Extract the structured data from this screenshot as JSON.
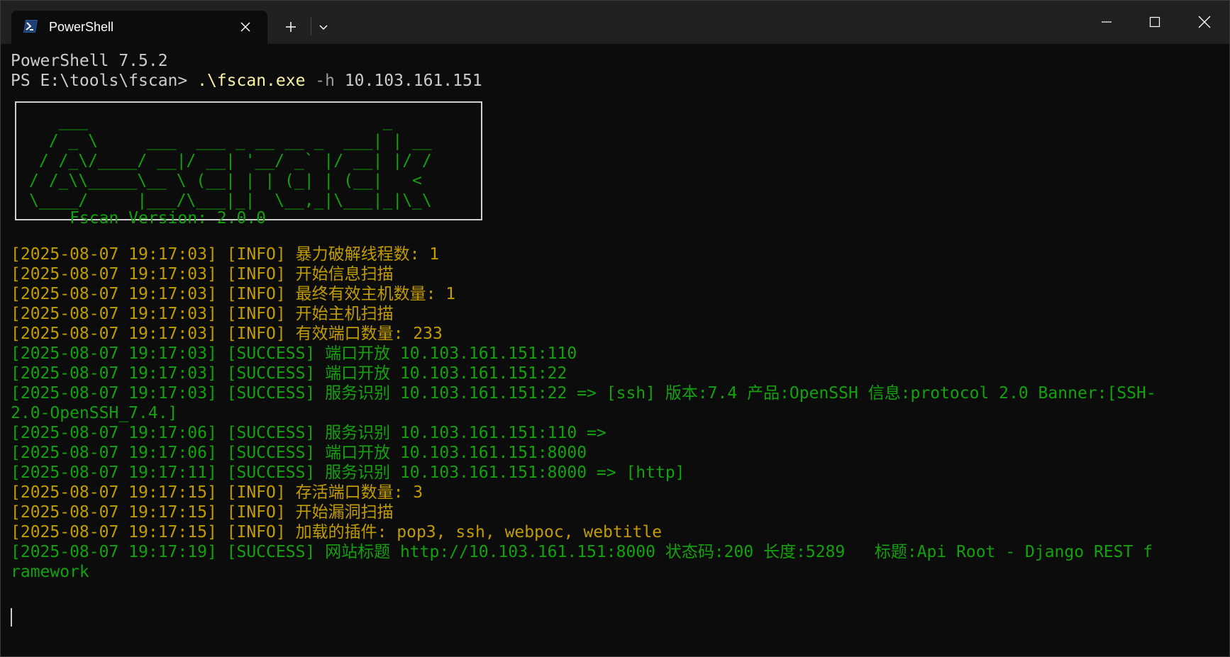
{
  "window": {
    "tab_title": "PowerShell",
    "icons": {
      "tab": "powershell-icon",
      "tab_close": "close-icon",
      "new_tab": "plus-icon",
      "dropdown": "chevron-down-icon",
      "minimize": "minimize-icon",
      "maximize": "maximize-icon",
      "close": "close-icon"
    }
  },
  "colors": {
    "background": "#0c0c0c",
    "titlebar": "#202020",
    "info": "#c19c00",
    "success": "#13a10e",
    "command": "#f9f1a5"
  },
  "terminal": {
    "version_line": "PowerShell 7.5.2",
    "prompt": "PS E:\\tools\\fscan> ",
    "command": ".\\fscan.exe",
    "flag": " -h",
    "argument": " 10.103.161.151",
    "banner": "   ___                              _    \n  / _ \\     ___  ___ _ __ __ _  ___| | __\n / /_\\/____/ __|/ __| '__/ _` |/ __| |/ /\n/ /_\\\\_____\\__ \\ (__| | | (_| | (__|   < \n\\____/     |___/\\___|_|  \\__,_|\\___|_|\\_\\",
    "fscan_version": "      Fscan Version: 2.0.0",
    "log": [
      {
        "type": "info",
        "text": "[2025-08-07 19:17:03] [INFO] 暴力破解线程数: 1"
      },
      {
        "type": "info",
        "text": "[2025-08-07 19:17:03] [INFO] 开始信息扫描"
      },
      {
        "type": "info",
        "text": "[2025-08-07 19:17:03] [INFO] 最终有效主机数量: 1"
      },
      {
        "type": "info",
        "text": "[2025-08-07 19:17:03] [INFO] 开始主机扫描"
      },
      {
        "type": "info",
        "text": "[2025-08-07 19:17:03] [INFO] 有效端口数量: 233"
      },
      {
        "type": "success",
        "text": "[2025-08-07 19:17:03] [SUCCESS] 端口开放 10.103.161.151:110"
      },
      {
        "type": "success",
        "text": "[2025-08-07 19:17:03] [SUCCESS] 端口开放 10.103.161.151:22"
      },
      {
        "type": "success",
        "text": "[2025-08-07 19:17:03] [SUCCESS] 服务识别 10.103.161.151:22 => [ssh] 版本:7.4 产品:OpenSSH 信息:protocol 2.0 Banner:[SSH-"
      },
      {
        "type": "success",
        "text": "2.0-OpenSSH_7.4.]"
      },
      {
        "type": "success",
        "text": "[2025-08-07 19:17:06] [SUCCESS] 服务识别 10.103.161.151:110 =>"
      },
      {
        "type": "success",
        "text": "[2025-08-07 19:17:06] [SUCCESS] 端口开放 10.103.161.151:8000"
      },
      {
        "type": "success",
        "text": "[2025-08-07 19:17:11] [SUCCESS] 服务识别 10.103.161.151:8000 => [http]"
      },
      {
        "type": "info",
        "text": "[2025-08-07 19:17:15] [INFO] 存活端口数量: 3"
      },
      {
        "type": "info",
        "text": "[2025-08-07 19:17:15] [INFO] 开始漏洞扫描"
      },
      {
        "type": "info",
        "text": "[2025-08-07 19:17:15] [INFO] 加载的插件: pop3, ssh, webpoc, webtitle"
      },
      {
        "type": "success",
        "text": "[2025-08-07 19:17:19] [SUCCESS] 网站标题 http://10.103.161.151:8000 状态码:200 长度:5289   标题:Api Root - Django REST f"
      },
      {
        "type": "success",
        "text": "ramework"
      }
    ]
  }
}
